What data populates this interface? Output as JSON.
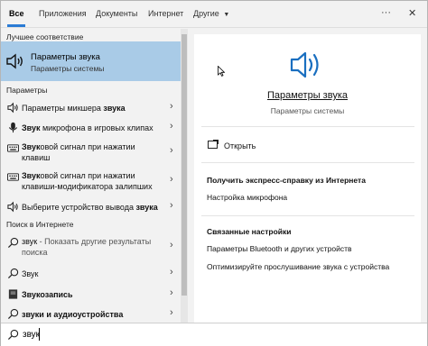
{
  "tabs": {
    "all": "Все",
    "apps": "Приложения",
    "documents": "Документы",
    "internet": "Интернет",
    "other": "Другие"
  },
  "top_icons": {
    "more": "···",
    "close": "✕"
  },
  "sections": {
    "best_match": "Лучшее соответствие",
    "settings": "Параметры",
    "web_search": "Поиск в Интернете"
  },
  "best_match": {
    "title": "Параметры звука",
    "subtitle": "Параметры системы",
    "icon": "speaker-icon"
  },
  "settings_items": [
    {
      "pre": "Параметры микшера ",
      "bold": "звука",
      "post": "",
      "line2": ""
    },
    {
      "pre": "",
      "bold": "Звук",
      "post": " микрофона в игровых клипах",
      "line2": ""
    },
    {
      "pre": "",
      "bold": "Звук",
      "post": "овой сигнал при нажатии",
      "line2": "клавиш"
    },
    {
      "pre": "",
      "bold": "Звук",
      "post": "овой сигнал при нажатии",
      "line2": "клавиши-модификатора залипших"
    },
    {
      "pre": "Выберите устройство вывода ",
      "bold": "звука",
      "post": "",
      "line2": ""
    }
  ],
  "web_items": [
    {
      "pre": "звук",
      "sub": " - Показать другие результаты",
      "line2": "поиска"
    },
    {
      "pre": "Звук",
      "sub": "",
      "line2": ""
    },
    {
      "pre": "Звукозапись",
      "sub": "",
      "line2": ""
    },
    {
      "pre": "звуки и аудиоустройства",
      "sub": "",
      "line2": ""
    }
  ],
  "preview": {
    "title": "Параметры звука",
    "subtitle": "Параметры системы",
    "open_label": "Открыть",
    "help_header": "Получить экспресс-справку из Интернета",
    "help_link": "Настройка микрофона",
    "related_header": "Связанные настройки",
    "related_links": [
      "Параметры Bluetooth и других устройств",
      "Оптимизируйте прослушивание звука с устройства"
    ]
  },
  "search": {
    "value": "звук"
  },
  "colors": {
    "accent": "#2a7bd4",
    "selected_bg": "#a9cbe7",
    "speaker_blue": "#1a6fc0"
  }
}
